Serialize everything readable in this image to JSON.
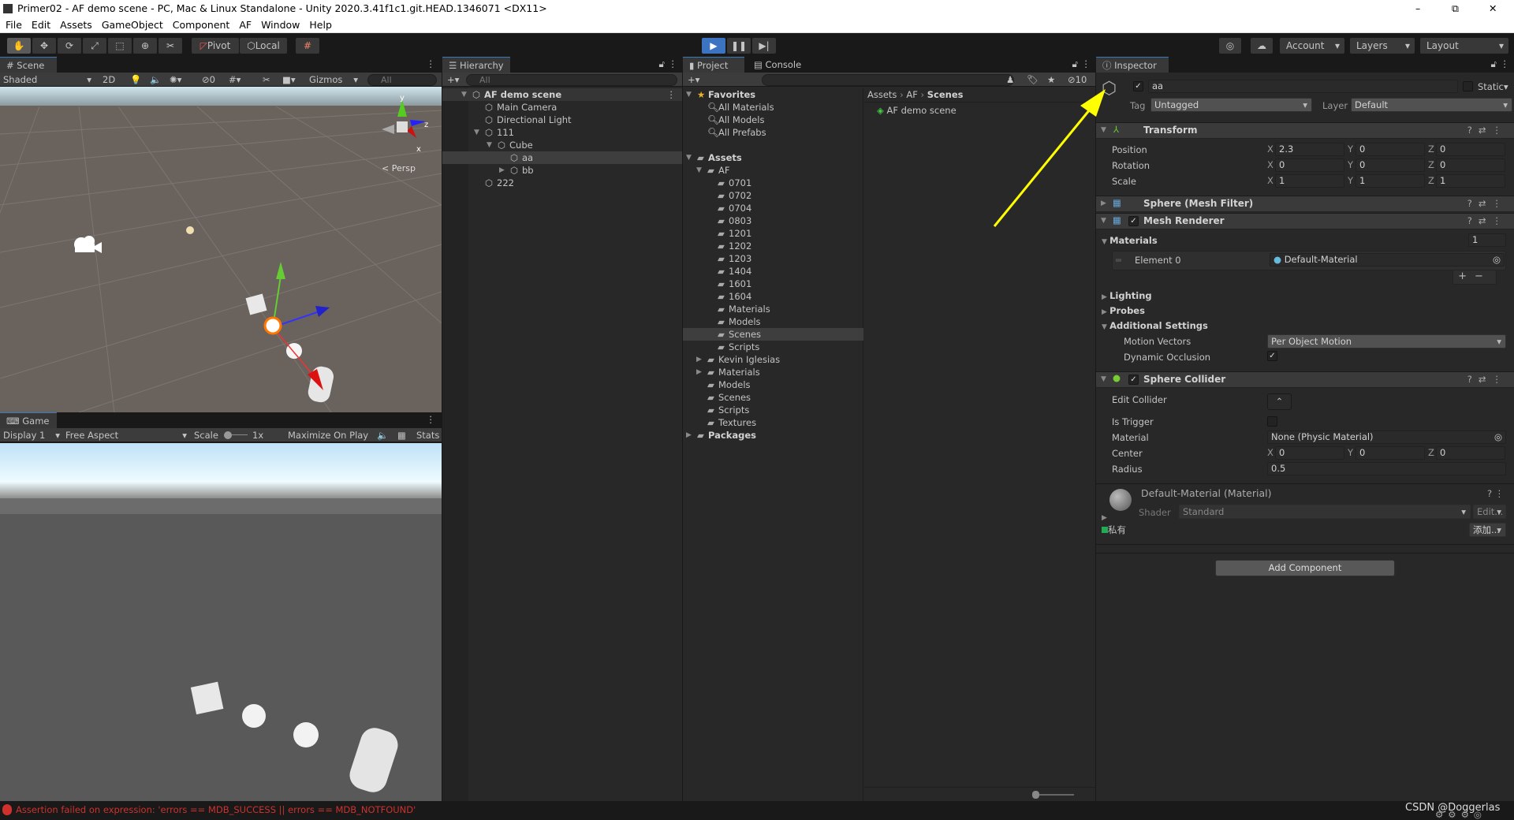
{
  "window": {
    "title": "Primer02 - AF demo scene - PC, Mac & Linux Standalone - Unity 2020.3.41f1c1.git.HEAD.1346071 <DX11>",
    "controls": [
      "–",
      "⧉",
      "✕"
    ]
  },
  "menu": [
    "File",
    "Edit",
    "Assets",
    "GameObject",
    "Component",
    "AF",
    "Window",
    "Help"
  ],
  "toolbar": {
    "tools": [
      "hand-tool",
      "move-tool",
      "rotate-tool",
      "scale-tool",
      "rect-tool",
      "transform-tool",
      "custom-tool"
    ],
    "pivot": "Pivot",
    "local": "Local",
    "account": "Account",
    "layers": "Layers",
    "layout": "Layout"
  },
  "scene": {
    "tab": "Scene",
    "shading": "Shaded",
    "mode2d": "2D",
    "hidden_count": "0",
    "gizmos": "Gizmos",
    "search_placeholder": "All",
    "persp": "Persp",
    "axis_y": "y",
    "axis_z": "z",
    "axis_x": "x"
  },
  "game": {
    "tab": "Game",
    "display": "Display 1",
    "aspect": "Free Aspect",
    "scale_label": "Scale",
    "scale_value": "1x",
    "maximize": "Maximize On Play",
    "stats": "Stats"
  },
  "hierarchy": {
    "tab": "Hierarchy",
    "search_placeholder": "All",
    "items": [
      {
        "label": "AF demo scene",
        "depth": 0,
        "expand": "open",
        "scene": true
      },
      {
        "label": "Main Camera",
        "depth": 1,
        "expand": ""
      },
      {
        "label": "Directional Light",
        "depth": 1,
        "expand": ""
      },
      {
        "label": "111",
        "depth": 1,
        "expand": "open"
      },
      {
        "label": "Cube",
        "depth": 2,
        "expand": "open"
      },
      {
        "label": "aa",
        "depth": 3,
        "expand": "",
        "selected": true
      },
      {
        "label": "bb",
        "depth": 3,
        "expand": "closed"
      },
      {
        "label": "222",
        "depth": 1,
        "expand": ""
      }
    ]
  },
  "project": {
    "tab": "Project",
    "console_tab": "Console",
    "hidden_count": "10",
    "breadcrumb": [
      "Assets",
      "AF",
      "Scenes"
    ],
    "files": [
      "AF demo scene"
    ],
    "tree": [
      {
        "label": "Favorites",
        "depth": 0,
        "expand": "open",
        "icon": "star",
        "bold": true
      },
      {
        "label": "All Materials",
        "depth": 1,
        "icon": "search"
      },
      {
        "label": "All Models",
        "depth": 1,
        "icon": "search"
      },
      {
        "label": "All Prefabs",
        "depth": 1,
        "icon": "search"
      },
      {
        "label": "",
        "depth": 0,
        "icon": ""
      },
      {
        "label": "Assets",
        "depth": 0,
        "expand": "open",
        "icon": "folder",
        "bold": true
      },
      {
        "label": "AF",
        "depth": 1,
        "expand": "open",
        "icon": "folder"
      },
      {
        "label": "0701",
        "depth": 2,
        "icon": "folder"
      },
      {
        "label": "0702",
        "depth": 2,
        "icon": "folder"
      },
      {
        "label": "0704",
        "depth": 2,
        "icon": "folder"
      },
      {
        "label": "0803",
        "depth": 2,
        "icon": "folder"
      },
      {
        "label": "1201",
        "depth": 2,
        "icon": "folder"
      },
      {
        "label": "1202",
        "depth": 2,
        "icon": "folder"
      },
      {
        "label": "1203",
        "depth": 2,
        "icon": "folder"
      },
      {
        "label": "1404",
        "depth": 2,
        "icon": "folder"
      },
      {
        "label": "1601",
        "depth": 2,
        "icon": "folder"
      },
      {
        "label": "1604",
        "depth": 2,
        "icon": "folder"
      },
      {
        "label": "Materials",
        "depth": 2,
        "icon": "folder"
      },
      {
        "label": "Models",
        "depth": 2,
        "icon": "folder"
      },
      {
        "label": "Scenes",
        "depth": 2,
        "icon": "folder",
        "selected": true
      },
      {
        "label": "Scripts",
        "depth": 2,
        "icon": "folder"
      },
      {
        "label": "Kevin Iglesias",
        "depth": 1,
        "expand": "closed",
        "icon": "folder"
      },
      {
        "label": "Materials",
        "depth": 1,
        "expand": "closed",
        "icon": "folder"
      },
      {
        "label": "Models",
        "depth": 1,
        "icon": "folder"
      },
      {
        "label": "Scenes",
        "depth": 1,
        "icon": "folder"
      },
      {
        "label": "Scripts",
        "depth": 1,
        "icon": "folder"
      },
      {
        "label": "Textures",
        "depth": 1,
        "icon": "folder"
      },
      {
        "label": "Packages",
        "depth": 0,
        "expand": "closed",
        "icon": "folder",
        "bold": true
      }
    ]
  },
  "inspector": {
    "tab": "Inspector",
    "name": "aa",
    "active": true,
    "static": "Static",
    "tag_label": "Tag",
    "tag": "Untagged",
    "layer_label": "Layer",
    "layer": "Default",
    "transform": {
      "title": "Transform",
      "position_label": "Position",
      "rotation_label": "Rotation",
      "scale_label": "Scale",
      "position": [
        "2.3",
        "0",
        "0"
      ],
      "rotation": [
        "0",
        "0",
        "0"
      ],
      "scale": [
        "1",
        "1",
        "1"
      ]
    },
    "mesh_filter": {
      "title": "Sphere (Mesh Filter)"
    },
    "mesh_renderer": {
      "title": "Mesh Renderer",
      "materials_label": "Materials",
      "materials_count": "1",
      "element_label": "Element 0",
      "element_value": "Default-Material",
      "lighting": "Lighting",
      "probes": "Probes",
      "additional": "Additional Settings",
      "motion_label": "Motion Vectors",
      "motion_value": "Per Object Motion",
      "occlusion_label": "Dynamic Occlusion",
      "occlusion": true
    },
    "sphere_collider": {
      "title": "Sphere Collider",
      "edit_label": "Edit Collider",
      "trigger_label": "Is Trigger",
      "material_label": "Material",
      "material_value": "None (Physic Material)",
      "center_label": "Center",
      "center": [
        "0",
        "0",
        "0"
      ],
      "radius_label": "Radius",
      "radius": "0.5"
    },
    "material": {
      "title": "Default-Material (Material)",
      "shader_label": "Shader",
      "shader": "Standard",
      "edit": "Edit...",
      "private": "私有",
      "add": "添加..."
    },
    "add_component": "Add Component"
  },
  "status": {
    "error": "Assertion failed on expression: 'errors == MDB_SUCCESS || errors == MDB_NOTFOUND'",
    "watermark": "CSDN @Doggerlas"
  },
  "colors": {
    "accent": "#3d74c1",
    "annotation_arrow": "#ffff00",
    "error": "#d0312d",
    "selection": "#3e3e3e"
  }
}
